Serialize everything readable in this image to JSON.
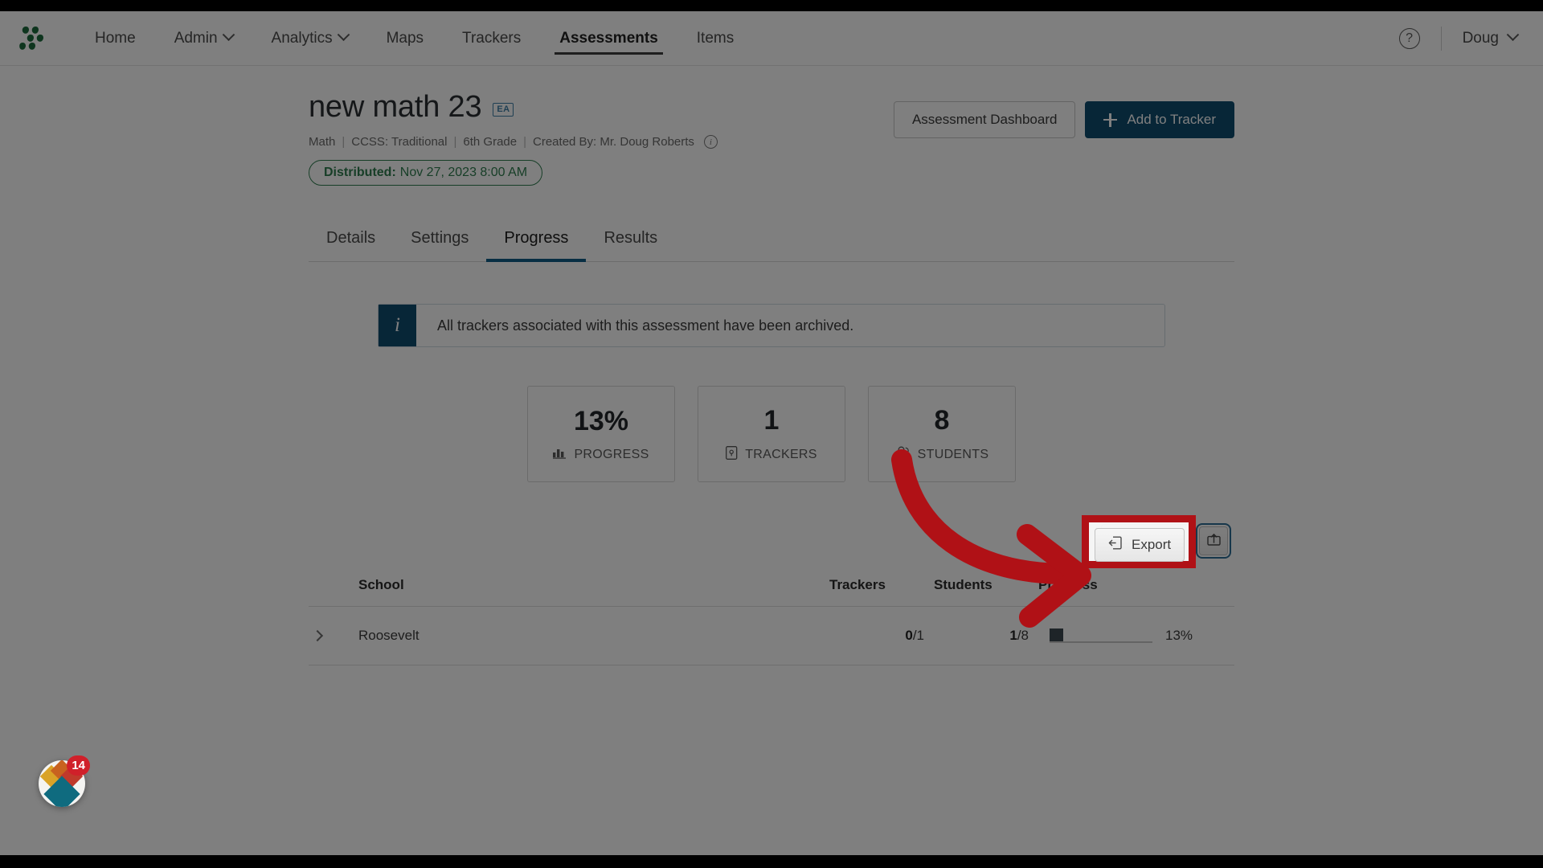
{
  "nav": {
    "logo_icon": "leaf-cluster-logo",
    "items": [
      {
        "label": "Home",
        "has_caret": false,
        "active": false
      },
      {
        "label": "Admin",
        "has_caret": true,
        "active": false
      },
      {
        "label": "Analytics",
        "has_caret": true,
        "active": false
      },
      {
        "label": "Maps",
        "has_caret": false,
        "active": false
      },
      {
        "label": "Trackers",
        "has_caret": false,
        "active": false
      },
      {
        "label": "Assessments",
        "has_caret": false,
        "active": true
      },
      {
        "label": "Items",
        "has_caret": false,
        "active": false
      }
    ],
    "help_label": "?",
    "user_label": "Doug"
  },
  "header": {
    "title": "new math 23",
    "badge": "EA",
    "meta": {
      "subject": "Math",
      "standard": "CCSS: Traditional",
      "grade": "6th Grade",
      "created_by": "Created By: Mr. Doug Roberts",
      "separator": "|"
    },
    "status_pill": {
      "label": "Distributed:",
      "value": "Nov 27, 2023 8:00 AM",
      "color": "#2e7d4f"
    },
    "actions": {
      "dashboard_label": "Assessment Dashboard",
      "add_tracker_label": "Add to Tracker"
    }
  },
  "tabs": [
    {
      "label": "Details",
      "active": false
    },
    {
      "label": "Settings",
      "active": false
    },
    {
      "label": "Progress",
      "active": true
    },
    {
      "label": "Results",
      "active": false
    }
  ],
  "banner": {
    "icon": "info-icon",
    "message": "All trackers associated with this assessment have been archived.",
    "accent_color": "#0f4c6e"
  },
  "stats": [
    {
      "value": "13%",
      "label": "PROGRESS",
      "icon": "bar-chart-icon"
    },
    {
      "value": "1",
      "label": "TRACKERS",
      "icon": "clipboard-icon"
    },
    {
      "value": "8",
      "label": "STUDENTS",
      "icon": "people-icon"
    }
  ],
  "toolbar": {
    "export_label": "Export",
    "export_icon": "export-icon",
    "share_icon": "upload-box-icon"
  },
  "table": {
    "columns": [
      "School",
      "Trackers",
      "Students",
      "Progress"
    ],
    "rows": [
      {
        "school": "Roosevelt",
        "trackers_done": "0",
        "trackers_total": "/1",
        "students_done": "1",
        "students_total": "/8",
        "progress_pct": "13%",
        "progress_value": 13
      }
    ]
  },
  "resource_widget": {
    "badge_count": "14",
    "icon": "resource-center-icon"
  },
  "annotation": {
    "arrow_color": "#b01116",
    "highlight_color": "#b01116",
    "highlight_target": "Export"
  }
}
